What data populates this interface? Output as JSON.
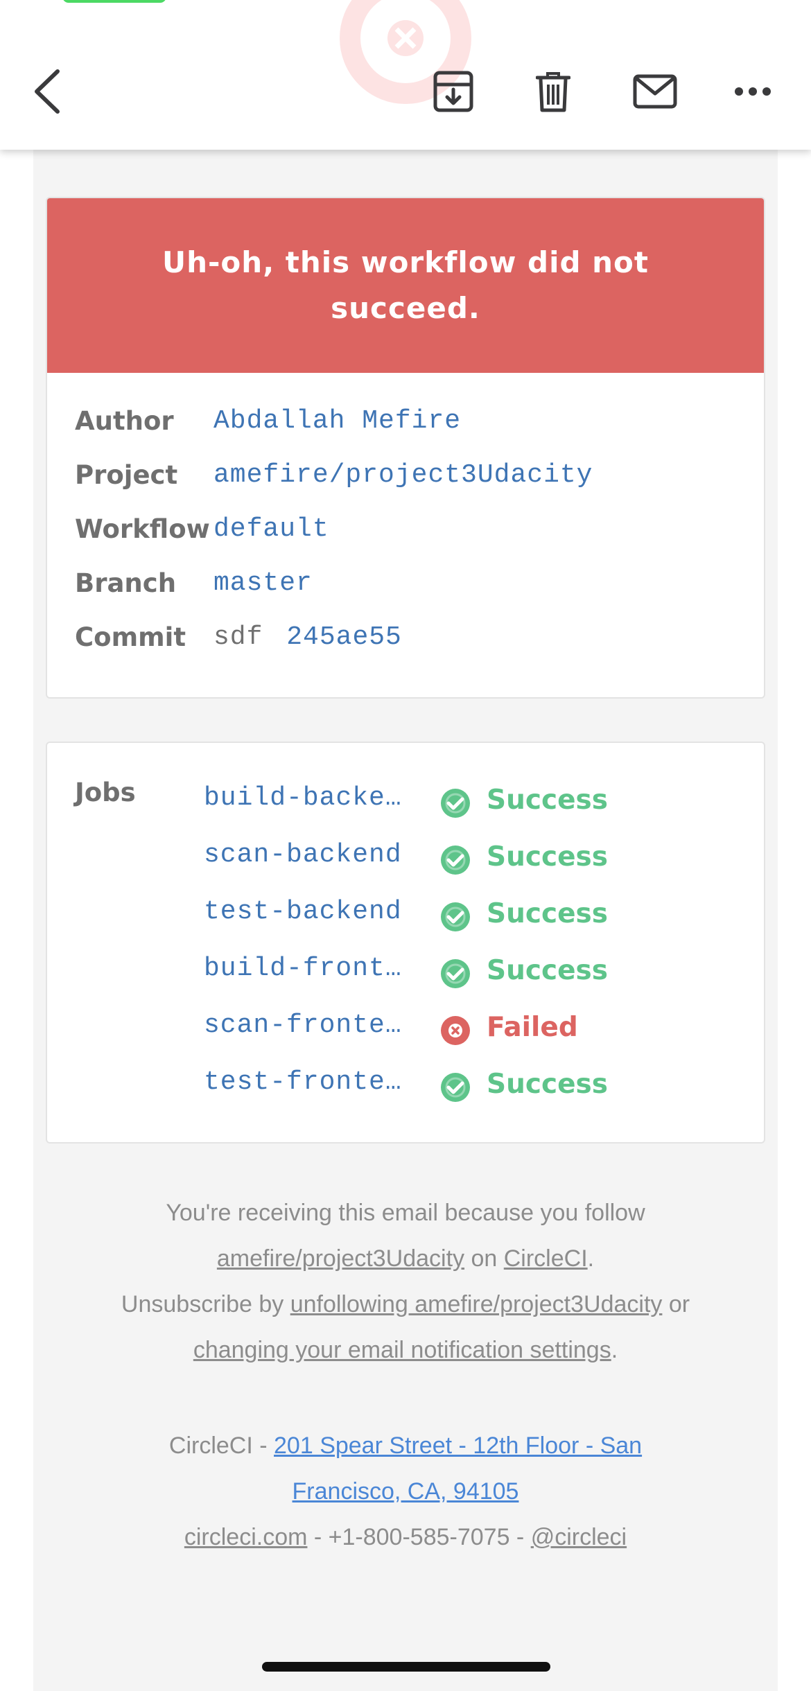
{
  "toolbar": {
    "back": "back",
    "archive": "archive",
    "trash": "trash",
    "mail": "mail",
    "more": "more"
  },
  "alert": {
    "message": "Uh-oh, this workflow did not succeed.",
    "color": "#dc6461"
  },
  "details": {
    "author_label": "Author",
    "author_value": "Abdallah Mefire",
    "project_label": "Project",
    "project_value": "amefire/project3Udacity",
    "workflow_label": "Workflow",
    "workflow_value": "default",
    "branch_label": "Branch",
    "branch_value": "master",
    "commit_label": "Commit",
    "commit_message": "sdf",
    "commit_hash": "245ae55"
  },
  "jobs": {
    "label": "Jobs",
    "items": [
      {
        "name": "build-backe…",
        "status": "Success"
      },
      {
        "name": "scan-backend",
        "status": "Success"
      },
      {
        "name": "test-backend",
        "status": "Success"
      },
      {
        "name": "build-front…",
        "status": "Success"
      },
      {
        "name": "scan-fronte…",
        "status": "Failed"
      },
      {
        "name": "test-fronte…",
        "status": "Success"
      }
    ],
    "success_color": "#5ec48a",
    "failed_color": "#dc6461"
  },
  "footer": {
    "line1": "You're receiving this email because you follow",
    "follow_link": "amefire/project3Udacity",
    "on_text": " on ",
    "circleci_link": "CircleCI",
    "period": ".",
    "unsub_prefix": "Unsubscribe by ",
    "unfollow_link": "unfollowing amefire/project3Udacity",
    "or_text": " or",
    "settings_link": "changing your email notification settings",
    "company": "CircleCI - ",
    "address_line1": "201 Spear Street - 12th Floor - San",
    "address_line2": "Francisco, CA, 94105",
    "site_link": "circleci.com",
    "phone": " - +1-800-585-7075 - ",
    "twitter_link": "@circleci"
  }
}
